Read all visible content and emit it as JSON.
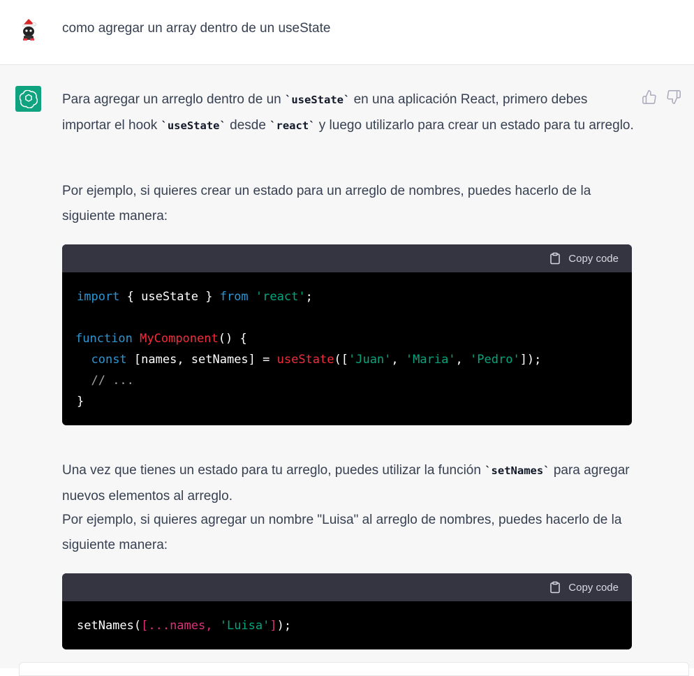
{
  "user_message": {
    "text": "como agregar un array dentro de un useState",
    "avatar_icon": "user-avatar-icon"
  },
  "assistant_message": {
    "avatar_icon": "openai-logo-icon",
    "feedback": {
      "thumbs_up_icon": "thumbs-up-icon",
      "thumbs_down_icon": "thumbs-down-icon"
    },
    "paragraph1": {
      "t1": "Para agregar un arreglo dentro de un ",
      "c1": "`useState`",
      "t2": " en una aplicación React, primero debes importar el hook ",
      "c2": "`useState`",
      "t3": " desde ",
      "c3": "`react`",
      "t4": " y luego utilizarlo para crear un estado para tu arreglo."
    },
    "paragraph2": "Por ejemplo, si quieres crear un estado para un arreglo de nombres, puedes hacerlo de la siguiente manera:",
    "code_block_1": {
      "copy_label": "Copy code",
      "lines": [
        "import { useState } from 'react';",
        "",
        "function MyComponent() {",
        "  const [names, setNames] = useState(['Juan', 'Maria', 'Pedro']);",
        "  // ...",
        "}"
      ]
    },
    "paragraph3": {
      "t1": "Una vez que tienes un estado para tu arreglo, puedes utilizar la función ",
      "c1": "`setNames`",
      "t2": " para agregar nuevos elementos al arreglo."
    },
    "paragraph4": "Por ejemplo, si quieres agregar un nombre \"Luisa\" al arreglo de nombres, puedes hacerlo de la siguiente manera:",
    "code_block_2": {
      "copy_label": "Copy code",
      "lines": [
        "setNames([...names, 'Luisa']);"
      ]
    }
  },
  "colors": {
    "assistant_bg": "#f7f7f8",
    "brand_green": "#10a37f",
    "code_header": "#343541",
    "keyword_blue": "#2e95d3",
    "string_green": "#00a67d",
    "function_red": "#f22c3d"
  }
}
